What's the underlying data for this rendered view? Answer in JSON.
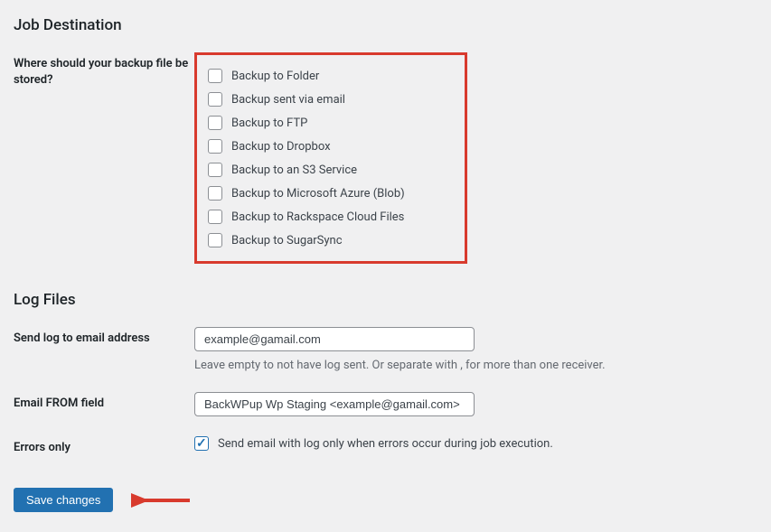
{
  "sections": {
    "job_destination": {
      "title": "Job Destination",
      "store_label": "Where should your backup file be stored?",
      "options": [
        "Backup to Folder",
        "Backup sent via email",
        "Backup to FTP",
        "Backup to Dropbox",
        "Backup to an S3 Service",
        "Backup to Microsoft Azure (Blob)",
        "Backup to Rackspace Cloud Files",
        "Backup to SugarSync"
      ]
    },
    "log_files": {
      "title": "Log Files",
      "send_log_label": "Send log to email address",
      "send_log_value": "example@gamail.com",
      "send_log_help": "Leave empty to not have log sent. Or separate with , for more than one receiver.",
      "from_label": "Email FROM field",
      "from_value": "BackWPup Wp Staging <example@gamail.com>",
      "errors_only_label": "Errors only",
      "errors_only_text": "Send email with log only when errors occur during job execution."
    },
    "submit": {
      "label": "Save changes"
    }
  }
}
